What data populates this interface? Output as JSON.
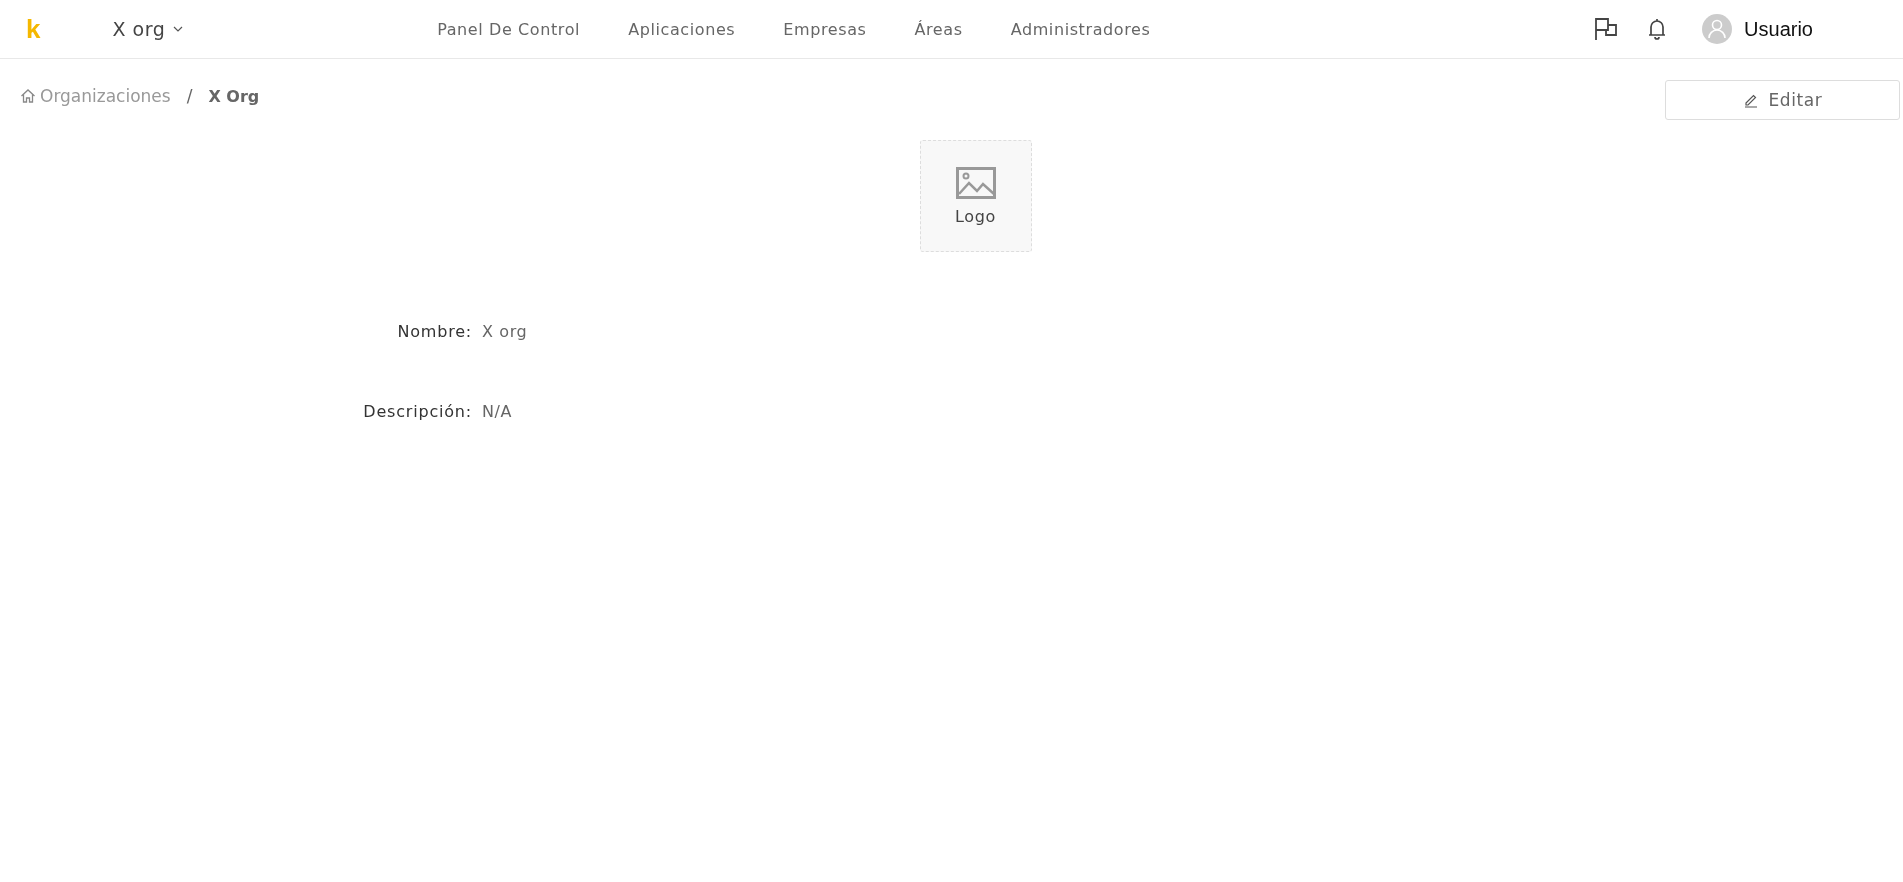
{
  "header": {
    "brand": "k",
    "org_selector": "X org",
    "nav": [
      {
        "label": "Panel De Control",
        "selected": false
      },
      {
        "label": "Aplicaciones",
        "selected": false
      },
      {
        "label": "Empresas",
        "selected": false
      },
      {
        "label": "Áreas",
        "selected": false
      },
      {
        "label": "Administradores",
        "selected": false
      }
    ],
    "user": "Usuario"
  },
  "breadcrumb": [
    "Organizaciones",
    "X Org"
  ],
  "breadcrumb_separator": "/",
  "edit_button": "Editar",
  "logo_placeholder": "Logo",
  "fields": [
    {
      "label": "Nombre:",
      "value": "X org"
    },
    {
      "label": "Descripción:",
      "value": "N/A"
    }
  ]
}
